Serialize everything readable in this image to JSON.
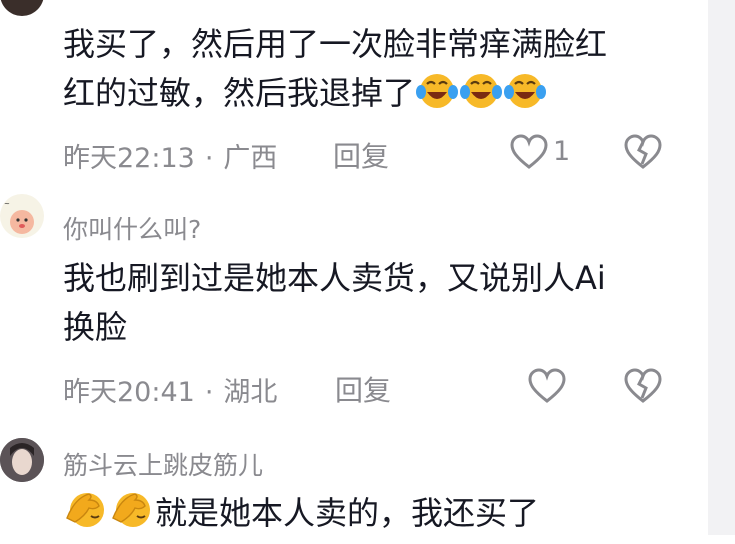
{
  "scrollbar": {
    "color": "#f2f2f4"
  },
  "comments": [
    {
      "username": "",
      "text_line1": "我买了，然后用了一次脸非常痒满脸红",
      "text_line2": "红的过敏，然后我退掉了",
      "emoji": "crying-laughing-emoji",
      "emoji_count": 3,
      "time": "昨天22:13",
      "location": "广西",
      "separator": "·",
      "reply_label": "回复",
      "like_count": "1",
      "liked": false
    },
    {
      "username": "你叫什么叫?",
      "text_line1": "我也刷到过是她本人卖货，又说别人Ai",
      "text_line2": "换脸",
      "time": "昨天20:41",
      "location": "湖北",
      "separator": "·",
      "reply_label": "回复",
      "liked": false
    },
    {
      "username": "筋斗云上跳皮筋儿",
      "text_line1": "就是她本人卖的，我还买了",
      "emoji": "facepalm-emoji",
      "emoji_count": 2
    }
  ],
  "colors": {
    "text": "#161823",
    "secondary": "#8a8a8f",
    "emoji_yellow": "#f7b928"
  }
}
